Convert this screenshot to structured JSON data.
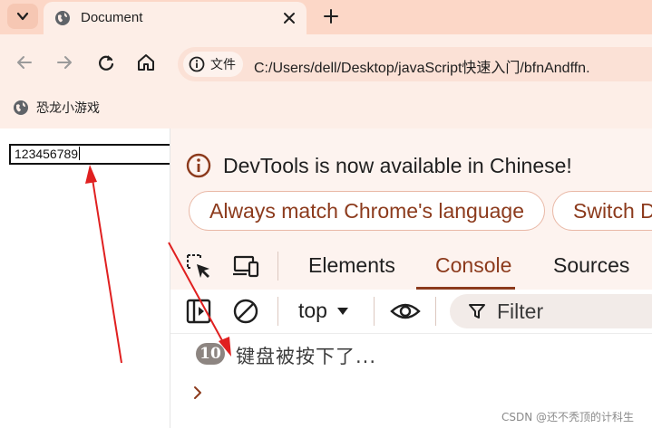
{
  "browser": {
    "tab_title": "Document",
    "site_chip_label": "文件",
    "url": "C:/Users/dell/Desktop/javaScript快速入门/bfnAndffn.",
    "bookmark_label": "恐龙小游戏"
  },
  "page": {
    "input_value": "123456789"
  },
  "devtools": {
    "notice_text": "DevTools is now available in Chinese!",
    "notice_buttons": [
      "Always match Chrome's language",
      "Switch D"
    ],
    "tabs": [
      "Elements",
      "Console",
      "Sources"
    ],
    "active_tab": "Console",
    "context": "top",
    "filter_placeholder": "Filter",
    "log": {
      "count": "10",
      "message": "键盘被按下了..."
    }
  },
  "watermark": "CSDN @还不秃顶的计科生",
  "colors": {
    "accent": "#8c3a1c",
    "annotation_arrow": "#e02020"
  }
}
